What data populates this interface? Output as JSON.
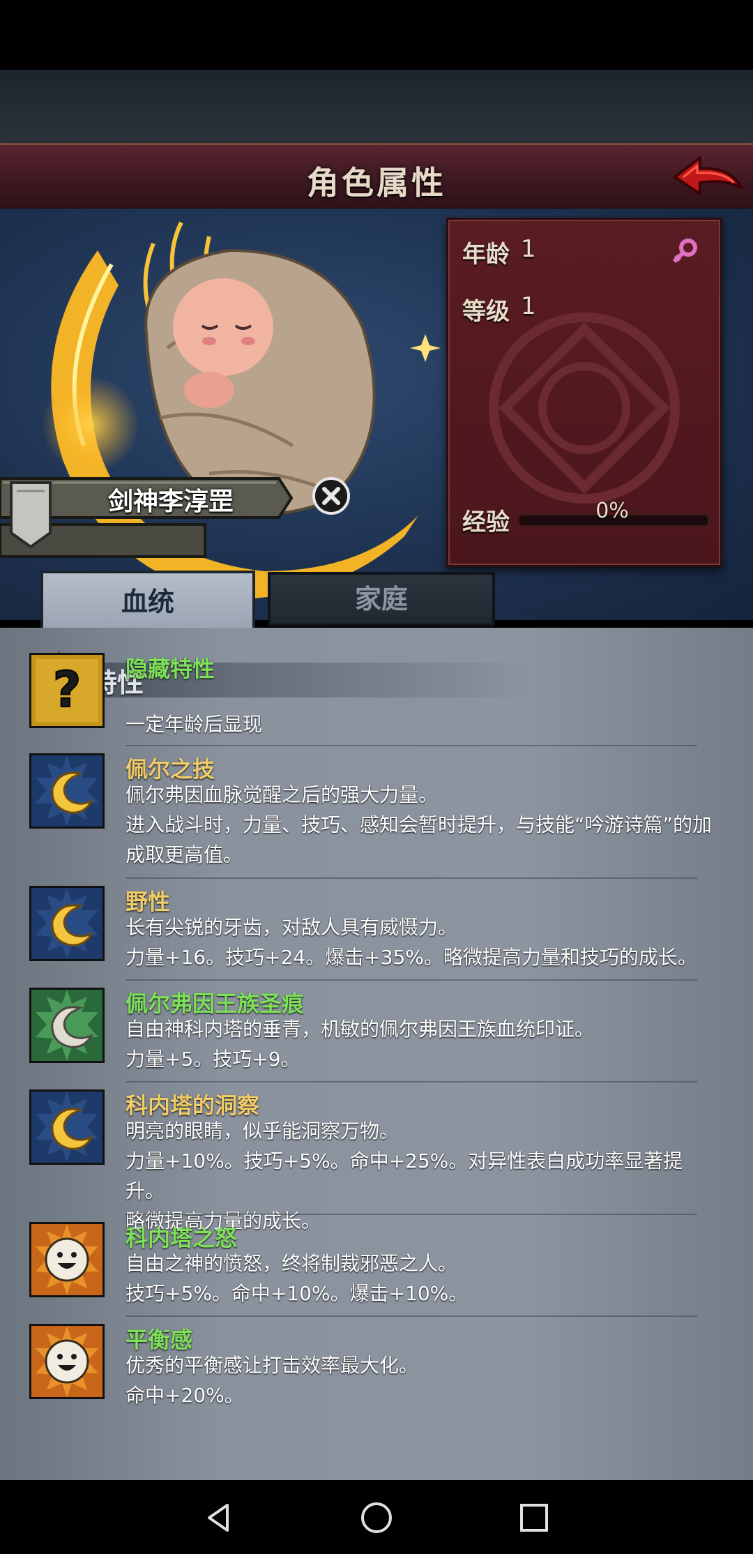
{
  "header": {
    "title": "角色属性"
  },
  "character": {
    "name": "剑神李淳罡",
    "stats": {
      "age_label": "年龄",
      "age_value": "1",
      "level_label": "等级",
      "level_value": "1",
      "exp_label": "经验",
      "exp_text": "0%",
      "exp_fraction": 0.0
    }
  },
  "tabs": [
    {
      "label": "血统",
      "active": true
    },
    {
      "label": "家庭",
      "active": false
    }
  ],
  "section": {
    "title": "特性"
  },
  "traits": [
    {
      "name": "隐藏特性",
      "name_color": "#7ee05a",
      "icon": "question-icon",
      "lines": [
        "",
        "一定年龄后显现"
      ]
    },
    {
      "name": "佩尔之技",
      "name_color": "#f0cc6a",
      "icon": "moon-icon",
      "lines": [
        "佩尔弗因血脉觉醒之后的强大力量。",
        "进入战斗时，力量、技巧、感知会暂时提升，与技能“吟游诗篇”的加",
        "成取更高值。"
      ]
    },
    {
      "name": "野性",
      "name_color": "#f0cc6a",
      "icon": "moon-icon",
      "lines": [
        "长有尖锐的牙齿，对敌人具有威慑力。",
        "力量+16。技巧+24。爆击+35%。略微提高力量和技巧的成长。"
      ]
    },
    {
      "name": "佩尔弗因王族圣痕",
      "name_color": "#7ee05a",
      "icon": "moon-green-icon",
      "lines": [
        "自由神科内塔的垂青，机敏的佩尔弗因王族血统印证。",
        "力量+5。技巧+9。"
      ]
    },
    {
      "name": "科内塔的洞察",
      "name_color": "#f0cc6a",
      "icon": "moon-icon",
      "lines": [
        "明亮的眼睛，似乎能洞察万物。",
        "力量+10%。技巧+5%。命中+25%。对异性表白成功率显著提升。",
        "略微提高力量的成长。"
      ]
    },
    {
      "name": "科内塔之怒",
      "name_color": "#7ee05a",
      "icon": "sun-face-icon",
      "lines": [
        "自由之神的愤怒，终将制裁邪恶之人。",
        "技巧+5%。命中+10%。爆击+10%。"
      ]
    },
    {
      "name": "平衡感",
      "name_color": "#7ee05a",
      "icon": "sun-face-icon",
      "lines": [
        "优秀的平衡感让打击效率最大化。",
        "命中+20%。"
      ]
    }
  ]
}
